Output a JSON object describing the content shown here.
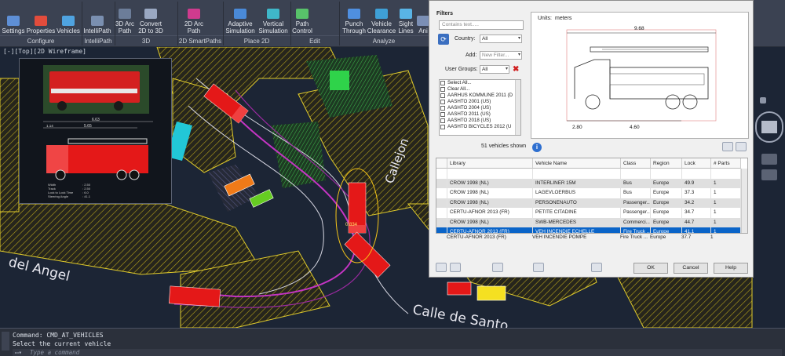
{
  "ribbon": {
    "buttons": [
      {
        "label": "Settings"
      },
      {
        "label": "Properties"
      },
      {
        "label": "Vehicles"
      },
      {
        "label": "IntelliPath"
      },
      {
        "label": "3D Arc Path"
      },
      {
        "label": "Convert 2D to 3D"
      },
      {
        "label": "2D Arc Path"
      },
      {
        "label": "Adaptive Simulation"
      },
      {
        "label": "Vertical Simulation"
      },
      {
        "label": "Path Control"
      },
      {
        "label": "Punch Through"
      },
      {
        "label": "Vehicle Clearance"
      },
      {
        "label": "Sight Lines"
      },
      {
        "label": "Ani"
      }
    ],
    "groups": [
      "Configure",
      "IntelliPath",
      "3D",
      "2D SmartPaths",
      "Place 2D",
      "Edit",
      "Analyze"
    ]
  },
  "viewport": {
    "label": "[-][Top][2D Wireframe]",
    "street_labels": [
      "del Angel",
      "Calle de Santo",
      "Callejon"
    ],
    "thumb_dims": {
      "top_len": "6.63",
      "sub_len": "5.65",
      "left_dim": "1.14",
      "specs": [
        "Width",
        "Track",
        "Lock to Lock Time",
        "Steering Angle"
      ],
      "spec_vals": [
        ": 2.50",
        ": 2.50",
        ": 6.0",
        ": 41.1"
      ]
    },
    "path_label": "0.834"
  },
  "dialog": {
    "filters_label": "Filters",
    "search_placeholder": "Contains text.....",
    "country_label": "Country:",
    "country_value": "All",
    "add_label": "Add:",
    "add_value": "New Filter...",
    "groups_label": "User Groups:",
    "groups_value": "All",
    "library_items": [
      "Select All...",
      "Clear All...",
      "AARHUS KOMMUNE 2011 (D",
      "AASHTO 2001 (US)",
      "AASHTO 2004 (US)",
      "AASHTO 2011 (US)",
      "AASHTO 2018 (US)",
      "AASHTO BICYCLES 2012 (U"
    ],
    "vehicles_shown": "51 vehicles shown",
    "units_label": "Units:",
    "units_value": "meters",
    "preview_dims": {
      "overall": "9.68",
      "front": "2.80",
      "wheelbase": "4.60"
    },
    "columns": [
      "Library",
      "Vehicle Name",
      "Class",
      "Region",
      "Lock",
      "# Parts"
    ],
    "rows": [
      {
        "library": "",
        "name": "",
        "class": "",
        "region": "",
        "lock": "",
        "parts": ""
      },
      {
        "library": "CROW 1998 (NL)",
        "name": "INTERLINER 15M",
        "class": "Bus",
        "region": "Europe",
        "lock": "49.9",
        "parts": "1"
      },
      {
        "library": "CROW 1998 (NL)",
        "name": "LAGEVLOERBUS",
        "class": "Bus",
        "region": "Europe",
        "lock": "37.3",
        "parts": "1"
      },
      {
        "library": "CROW 1998 (NL)",
        "name": "PERSONENAUTO",
        "class": "Passenger...",
        "region": "Europe",
        "lock": "34.2",
        "parts": "1"
      },
      {
        "library": "CERTU-AFNOR 2013 (FR)",
        "name": "PETITE CITADINE",
        "class": "Passenger...",
        "region": "Europe",
        "lock": "34.7",
        "parts": "1"
      },
      {
        "library": "CROW 1998 (NL)",
        "name": "SWB-MERCEDES",
        "class": "Commerci...",
        "region": "Europe",
        "lock": "44.7",
        "parts": "1"
      },
      {
        "library": "CERTU-AFNOR 2013 (FR)",
        "name": "VEH INCENDIE ECHELLE",
        "class": "Fire Truck ...",
        "region": "Europe",
        "lock": "41.1",
        "parts": "1"
      },
      {
        "library": "CERTU-AFNOR 2013 (FR)",
        "name": "VEH INCENDIE POMPE",
        "class": "Fire Truck ...",
        "region": "Europe",
        "lock": "37.7",
        "parts": "1"
      }
    ],
    "ok_label": "OK",
    "cancel_label": "Cancel",
    "help_label": "Help"
  },
  "command": {
    "line1": "Command: CMD_AT_VEHICLES",
    "line2": "Select the current vehicle",
    "input_placeholder": "Type a command"
  },
  "colors": {
    "accent_selected": "#0a64c8",
    "truck_red": "#e41818",
    "hatch_yellow": "#d9c21e",
    "path_magenta": "#c535c4"
  }
}
